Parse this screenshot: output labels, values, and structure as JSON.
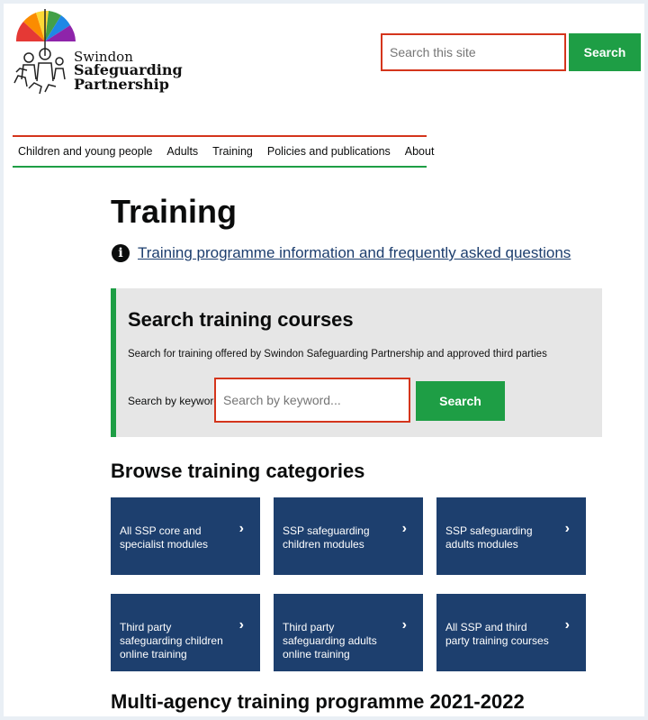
{
  "header": {
    "logo": {
      "line1": "Swindon",
      "line2": "Safeguarding",
      "line3": "Partnership"
    },
    "search_placeholder": "Search this site",
    "search_button": "Search"
  },
  "nav": {
    "items": [
      "Children and young people",
      "Adults",
      "Training",
      "Policies and publications",
      "About"
    ]
  },
  "main": {
    "title": "Training",
    "faq_link": "Training programme information and frequently asked questions",
    "search_section": {
      "heading": "Search training courses",
      "description": "Search for training offered by Swindon Safeguarding Partnership and approved third parties",
      "keyword_label": "Search by keyword",
      "keyword_placeholder": "Search by keyword...",
      "button": "Search"
    },
    "browse_heading": "Browse training categories",
    "categories": [
      "All SSP core and specialist modules",
      "SSP safeguarding children modules",
      "SSP safeguarding adults modules",
      "Third party safeguarding children online training",
      "Third party safeguarding adults online training",
      "All SSP and third party training courses"
    ],
    "programme_heading": "Multi-agency training programme 2021-2022"
  },
  "colors": {
    "accent_green": "#1e9e45",
    "accent_red": "#d4351c",
    "tile_blue": "#1d3f6e",
    "link_blue": "#1d3e6e"
  }
}
